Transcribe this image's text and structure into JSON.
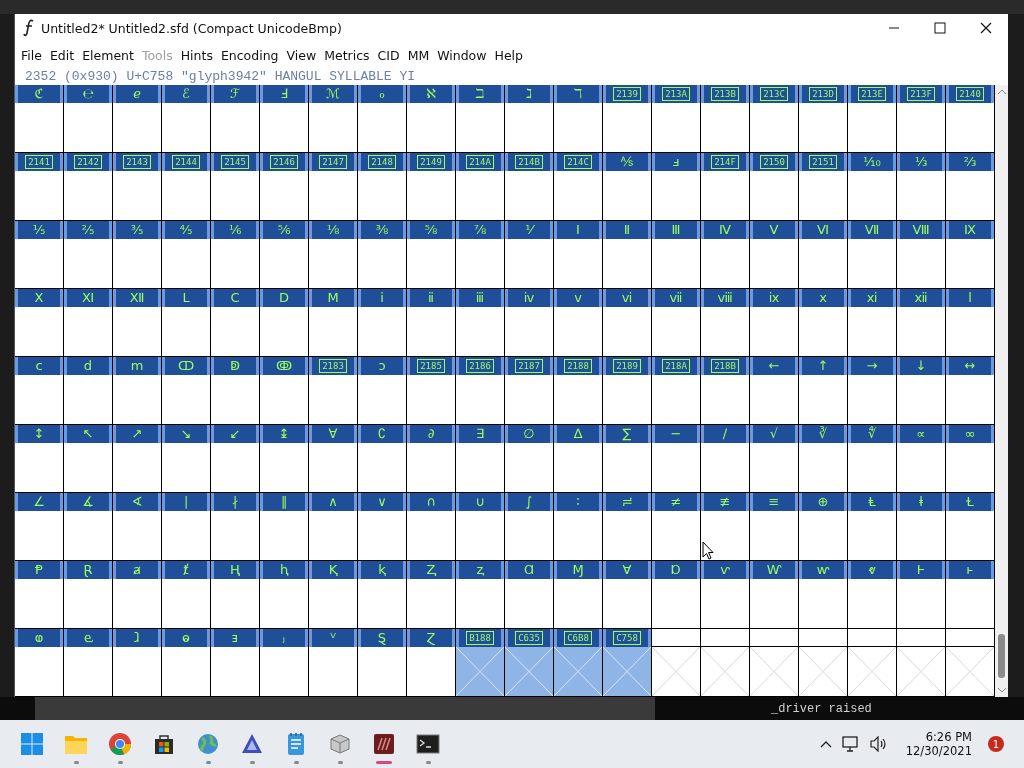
{
  "window": {
    "title": "Untitled2*  Untitled2.sfd (Compact UnicodeBmp)"
  },
  "menu": [
    {
      "label": "File",
      "disabled": false
    },
    {
      "label": "Edit",
      "disabled": false
    },
    {
      "label": "Element",
      "disabled": false
    },
    {
      "label": "Tools",
      "disabled": true
    },
    {
      "label": "Hints",
      "disabled": false
    },
    {
      "label": "Encoding",
      "disabled": false
    },
    {
      "label": "View",
      "disabled": false
    },
    {
      "label": "Metrics",
      "disabled": false
    },
    {
      "label": "CID",
      "disabled": false
    },
    {
      "label": "MM",
      "disabled": false
    },
    {
      "label": "Window",
      "disabled": false
    },
    {
      "label": "Help",
      "disabled": false
    }
  ],
  "status_line": "2352 (0x930) U+C758 \"glyph3942\" HANGUL SYLLABLE YI",
  "glyph_rows": [
    {
      "cells": [
        {
          "kind": "glyph",
          "label": "ℭ",
          "selected": false,
          "empty": false
        },
        {
          "kind": "glyph",
          "label": "℮",
          "selected": false,
          "empty": false
        },
        {
          "kind": "glyph",
          "label": "ℯ",
          "selected": false,
          "empty": false
        },
        {
          "kind": "glyph",
          "label": "ℰ",
          "selected": false,
          "empty": false
        },
        {
          "kind": "glyph",
          "label": "ℱ",
          "selected": false,
          "empty": false
        },
        {
          "kind": "glyph",
          "label": "Ⅎ",
          "selected": false,
          "empty": false
        },
        {
          "kind": "glyph",
          "label": "ℳ",
          "selected": false,
          "empty": false
        },
        {
          "kind": "glyph",
          "label": "ℴ",
          "selected": false,
          "empty": false
        },
        {
          "kind": "glyph",
          "label": "ℵ",
          "selected": false,
          "empty": false
        },
        {
          "kind": "glyph",
          "label": "ℶ",
          "selected": false,
          "empty": false
        },
        {
          "kind": "glyph",
          "label": "ℷ",
          "selected": false,
          "empty": false
        },
        {
          "kind": "glyph",
          "label": "ℸ",
          "selected": false,
          "empty": false
        },
        {
          "kind": "missing",
          "label": "2139",
          "selected": false,
          "empty": false
        },
        {
          "kind": "missing",
          "label": "213A",
          "selected": false,
          "empty": false
        },
        {
          "kind": "missing",
          "label": "213B",
          "selected": false,
          "empty": false
        },
        {
          "kind": "missing",
          "label": "213C",
          "selected": false,
          "empty": false
        },
        {
          "kind": "missing",
          "label": "213D",
          "selected": false,
          "empty": false
        },
        {
          "kind": "missing",
          "label": "213E",
          "selected": false,
          "empty": false
        },
        {
          "kind": "missing",
          "label": "213F",
          "selected": false,
          "empty": false
        },
        {
          "kind": "missing",
          "label": "2140",
          "selected": false,
          "empty": false
        }
      ]
    },
    {
      "cells": [
        {
          "kind": "missing",
          "label": "2141",
          "selected": false,
          "empty": false
        },
        {
          "kind": "missing",
          "label": "2142",
          "selected": false,
          "empty": false
        },
        {
          "kind": "missing",
          "label": "2143",
          "selected": false,
          "empty": false
        },
        {
          "kind": "missing",
          "label": "2144",
          "selected": false,
          "empty": false
        },
        {
          "kind": "missing",
          "label": "2145",
          "selected": false,
          "empty": false
        },
        {
          "kind": "missing",
          "label": "2146",
          "selected": false,
          "empty": false
        },
        {
          "kind": "missing",
          "label": "2147",
          "selected": false,
          "empty": false
        },
        {
          "kind": "missing",
          "label": "2148",
          "selected": false,
          "empty": false
        },
        {
          "kind": "missing",
          "label": "2149",
          "selected": false,
          "empty": false
        },
        {
          "kind": "missing",
          "label": "214A",
          "selected": false,
          "empty": false
        },
        {
          "kind": "missing",
          "label": "214B",
          "selected": false,
          "empty": false
        },
        {
          "kind": "missing",
          "label": "214C",
          "selected": false,
          "empty": false
        },
        {
          "kind": "glyph",
          "label": "⅍",
          "selected": false,
          "empty": false
        },
        {
          "kind": "glyph",
          "label": "ⅎ",
          "selected": false,
          "empty": false
        },
        {
          "kind": "missing",
          "label": "214F",
          "selected": false,
          "empty": false
        },
        {
          "kind": "missing",
          "label": "2150",
          "selected": false,
          "empty": false
        },
        {
          "kind": "missing",
          "label": "2151",
          "selected": false,
          "empty": false
        },
        {
          "kind": "glyph",
          "label": "⅒",
          "selected": false,
          "empty": false
        },
        {
          "kind": "glyph",
          "label": "⅓",
          "selected": false,
          "empty": false
        },
        {
          "kind": "glyph",
          "label": "⅔",
          "selected": false,
          "empty": false
        }
      ]
    },
    {
      "cells": [
        {
          "kind": "glyph",
          "label": "⅕",
          "selected": false,
          "empty": false
        },
        {
          "kind": "glyph",
          "label": "⅖",
          "selected": false,
          "empty": false
        },
        {
          "kind": "glyph",
          "label": "⅗",
          "selected": false,
          "empty": false
        },
        {
          "kind": "glyph",
          "label": "⅘",
          "selected": false,
          "empty": false
        },
        {
          "kind": "glyph",
          "label": "⅙",
          "selected": false,
          "empty": false
        },
        {
          "kind": "glyph",
          "label": "⅚",
          "selected": false,
          "empty": false
        },
        {
          "kind": "glyph",
          "label": "⅛",
          "selected": false,
          "empty": false
        },
        {
          "kind": "glyph",
          "label": "⅜",
          "selected": false,
          "empty": false
        },
        {
          "kind": "glyph",
          "label": "⅝",
          "selected": false,
          "empty": false
        },
        {
          "kind": "glyph",
          "label": "⅞",
          "selected": false,
          "empty": false
        },
        {
          "kind": "glyph",
          "label": "⅟",
          "selected": false,
          "empty": false
        },
        {
          "kind": "glyph",
          "label": "Ⅰ",
          "selected": false,
          "empty": false
        },
        {
          "kind": "glyph",
          "label": "Ⅱ",
          "selected": false,
          "empty": false
        },
        {
          "kind": "glyph",
          "label": "Ⅲ",
          "selected": false,
          "empty": false
        },
        {
          "kind": "glyph",
          "label": "Ⅳ",
          "selected": false,
          "empty": false
        },
        {
          "kind": "glyph",
          "label": "Ⅴ",
          "selected": false,
          "empty": false
        },
        {
          "kind": "glyph",
          "label": "Ⅵ",
          "selected": false,
          "empty": false
        },
        {
          "kind": "glyph",
          "label": "Ⅶ",
          "selected": false,
          "empty": false
        },
        {
          "kind": "glyph",
          "label": "Ⅷ",
          "selected": false,
          "empty": false
        },
        {
          "kind": "glyph",
          "label": "Ⅸ",
          "selected": false,
          "empty": false
        }
      ]
    },
    {
      "cells": [
        {
          "kind": "glyph",
          "label": "Ⅹ",
          "selected": false,
          "empty": false
        },
        {
          "kind": "glyph",
          "label": "Ⅺ",
          "selected": false,
          "empty": false
        },
        {
          "kind": "glyph",
          "label": "Ⅻ",
          "selected": false,
          "empty": false
        },
        {
          "kind": "glyph",
          "label": "Ⅼ",
          "selected": false,
          "empty": false
        },
        {
          "kind": "glyph",
          "label": "Ⅽ",
          "selected": false,
          "empty": false
        },
        {
          "kind": "glyph",
          "label": "Ⅾ",
          "selected": false,
          "empty": false
        },
        {
          "kind": "glyph",
          "label": "Ⅿ",
          "selected": false,
          "empty": false
        },
        {
          "kind": "glyph",
          "label": "ⅰ",
          "selected": false,
          "empty": false
        },
        {
          "kind": "glyph",
          "label": "ⅱ",
          "selected": false,
          "empty": false
        },
        {
          "kind": "glyph",
          "label": "ⅲ",
          "selected": false,
          "empty": false
        },
        {
          "kind": "glyph",
          "label": "ⅳ",
          "selected": false,
          "empty": false
        },
        {
          "kind": "glyph",
          "label": "ⅴ",
          "selected": false,
          "empty": false
        },
        {
          "kind": "glyph",
          "label": "ⅵ",
          "selected": false,
          "empty": false
        },
        {
          "kind": "glyph",
          "label": "ⅶ",
          "selected": false,
          "empty": false
        },
        {
          "kind": "glyph",
          "label": "ⅷ",
          "selected": false,
          "empty": false
        },
        {
          "kind": "glyph",
          "label": "ⅸ",
          "selected": false,
          "empty": false
        },
        {
          "kind": "glyph",
          "label": "ⅹ",
          "selected": false,
          "empty": false
        },
        {
          "kind": "glyph",
          "label": "ⅺ",
          "selected": false,
          "empty": false
        },
        {
          "kind": "glyph",
          "label": "ⅻ",
          "selected": false,
          "empty": false
        },
        {
          "kind": "glyph",
          "label": "ⅼ",
          "selected": false,
          "empty": false
        }
      ]
    },
    {
      "cells": [
        {
          "kind": "glyph",
          "label": "ⅽ",
          "selected": false,
          "empty": false
        },
        {
          "kind": "glyph",
          "label": "ⅾ",
          "selected": false,
          "empty": false
        },
        {
          "kind": "glyph",
          "label": "ⅿ",
          "selected": false,
          "empty": false
        },
        {
          "kind": "glyph",
          "label": "ↀ",
          "selected": false,
          "empty": false
        },
        {
          "kind": "glyph",
          "label": "ↁ",
          "selected": false,
          "empty": false
        },
        {
          "kind": "glyph",
          "label": "ↂ",
          "selected": false,
          "empty": false
        },
        {
          "kind": "missing",
          "label": "2183",
          "selected": false,
          "empty": false
        },
        {
          "kind": "glyph",
          "label": "ↄ",
          "selected": false,
          "empty": false
        },
        {
          "kind": "missing",
          "label": "2185",
          "selected": false,
          "empty": false
        },
        {
          "kind": "missing",
          "label": "2186",
          "selected": false,
          "empty": false
        },
        {
          "kind": "missing",
          "label": "2187",
          "selected": false,
          "empty": false
        },
        {
          "kind": "missing",
          "label": "2188",
          "selected": false,
          "empty": false
        },
        {
          "kind": "missing",
          "label": "2189",
          "selected": false,
          "empty": false
        },
        {
          "kind": "missing",
          "label": "218A",
          "selected": false,
          "empty": false
        },
        {
          "kind": "missing",
          "label": "218B",
          "selected": false,
          "empty": false
        },
        {
          "kind": "glyph",
          "label": "←",
          "selected": false,
          "empty": false
        },
        {
          "kind": "glyph",
          "label": "↑",
          "selected": false,
          "empty": false
        },
        {
          "kind": "glyph",
          "label": "→",
          "selected": false,
          "empty": false
        },
        {
          "kind": "glyph",
          "label": "↓",
          "selected": false,
          "empty": false
        },
        {
          "kind": "glyph",
          "label": "↔",
          "selected": false,
          "empty": false
        }
      ]
    },
    {
      "cells": [
        {
          "kind": "glyph",
          "label": "↕",
          "selected": false,
          "empty": false
        },
        {
          "kind": "glyph",
          "label": "↖",
          "selected": false,
          "empty": false
        },
        {
          "kind": "glyph",
          "label": "↗",
          "selected": false,
          "empty": false
        },
        {
          "kind": "glyph",
          "label": "↘",
          "selected": false,
          "empty": false
        },
        {
          "kind": "glyph",
          "label": "↙",
          "selected": false,
          "empty": false
        },
        {
          "kind": "glyph",
          "label": "↨",
          "selected": false,
          "empty": false
        },
        {
          "kind": "glyph",
          "label": "∀",
          "selected": false,
          "empty": false
        },
        {
          "kind": "glyph",
          "label": "∁",
          "selected": false,
          "empty": false
        },
        {
          "kind": "glyph",
          "label": "∂",
          "selected": false,
          "empty": false
        },
        {
          "kind": "glyph",
          "label": "∃",
          "selected": false,
          "empty": false
        },
        {
          "kind": "glyph",
          "label": "∅",
          "selected": false,
          "empty": false
        },
        {
          "kind": "glyph",
          "label": "∆",
          "selected": false,
          "empty": false
        },
        {
          "kind": "glyph",
          "label": "∑",
          "selected": false,
          "empty": false
        },
        {
          "kind": "glyph",
          "label": "−",
          "selected": false,
          "empty": false
        },
        {
          "kind": "glyph",
          "label": "∕",
          "selected": false,
          "empty": false
        },
        {
          "kind": "glyph",
          "label": "√",
          "selected": false,
          "empty": false
        },
        {
          "kind": "glyph",
          "label": "∛",
          "selected": false,
          "empty": false
        },
        {
          "kind": "glyph",
          "label": "∜",
          "selected": false,
          "empty": false
        },
        {
          "kind": "glyph",
          "label": "∝",
          "selected": false,
          "empty": false
        },
        {
          "kind": "glyph",
          "label": "∞",
          "selected": false,
          "empty": false
        }
      ]
    },
    {
      "cells": [
        {
          "kind": "glyph",
          "label": "∠",
          "selected": false,
          "empty": false
        },
        {
          "kind": "glyph",
          "label": "∡",
          "selected": false,
          "empty": false
        },
        {
          "kind": "glyph",
          "label": "∢",
          "selected": false,
          "empty": false
        },
        {
          "kind": "glyph",
          "label": "∣",
          "selected": false,
          "empty": false
        },
        {
          "kind": "glyph",
          "label": "∤",
          "selected": false,
          "empty": false
        },
        {
          "kind": "glyph",
          "label": "∥",
          "selected": false,
          "empty": false
        },
        {
          "kind": "glyph",
          "label": "∧",
          "selected": false,
          "empty": false
        },
        {
          "kind": "glyph",
          "label": "∨",
          "selected": false,
          "empty": false
        },
        {
          "kind": "glyph",
          "label": "∩",
          "selected": false,
          "empty": false
        },
        {
          "kind": "glyph",
          "label": "∪",
          "selected": false,
          "empty": false
        },
        {
          "kind": "glyph",
          "label": "∫",
          "selected": false,
          "empty": false
        },
        {
          "kind": "glyph",
          "label": "∶",
          "selected": false,
          "empty": false
        },
        {
          "kind": "glyph",
          "label": "≓",
          "selected": false,
          "empty": false
        },
        {
          "kind": "glyph",
          "label": "≠",
          "selected": false,
          "empty": false
        },
        {
          "kind": "glyph",
          "label": "≢",
          "selected": false,
          "empty": false
        },
        {
          "kind": "glyph",
          "label": "≡",
          "selected": false,
          "empty": false
        },
        {
          "kind": "glyph",
          "label": "⊕",
          "selected": false,
          "empty": false
        },
        {
          "kind": "glyph",
          "label": "Ⱡ",
          "selected": false,
          "empty": false
        },
        {
          "kind": "glyph",
          "label": "ⱡ",
          "selected": false,
          "empty": false
        },
        {
          "kind": "glyph",
          "label": "Ɫ",
          "selected": false,
          "empty": false
        }
      ]
    },
    {
      "cells": [
        {
          "kind": "glyph",
          "label": "Ᵽ",
          "selected": false,
          "empty": false
        },
        {
          "kind": "glyph",
          "label": "Ɽ",
          "selected": false,
          "empty": false
        },
        {
          "kind": "glyph",
          "label": "ⱥ",
          "selected": false,
          "empty": false
        },
        {
          "kind": "glyph",
          "label": "ⱦ",
          "selected": false,
          "empty": false
        },
        {
          "kind": "glyph",
          "label": "Ⱨ",
          "selected": false,
          "empty": false
        },
        {
          "kind": "glyph",
          "label": "ⱨ",
          "selected": false,
          "empty": false
        },
        {
          "kind": "glyph",
          "label": "Ⱪ",
          "selected": false,
          "empty": false
        },
        {
          "kind": "glyph",
          "label": "ⱪ",
          "selected": false,
          "empty": false
        },
        {
          "kind": "glyph",
          "label": "Ⱬ",
          "selected": false,
          "empty": false
        },
        {
          "kind": "glyph",
          "label": "ⱬ",
          "selected": false,
          "empty": false
        },
        {
          "kind": "glyph",
          "label": "Ɑ",
          "selected": false,
          "empty": false
        },
        {
          "kind": "glyph",
          "label": "Ɱ",
          "selected": false,
          "empty": false
        },
        {
          "kind": "glyph",
          "label": "Ɐ",
          "selected": false,
          "empty": false
        },
        {
          "kind": "glyph",
          "label": "Ɒ",
          "selected": false,
          "empty": false
        },
        {
          "kind": "glyph",
          "label": "ⱱ",
          "selected": false,
          "empty": false
        },
        {
          "kind": "glyph",
          "label": "Ⱳ",
          "selected": false,
          "empty": false
        },
        {
          "kind": "glyph",
          "label": "ⱳ",
          "selected": false,
          "empty": false
        },
        {
          "kind": "glyph",
          "label": "ⱴ",
          "selected": false,
          "empty": false
        },
        {
          "kind": "glyph",
          "label": "Ⱶ",
          "selected": false,
          "empty": false
        },
        {
          "kind": "glyph",
          "label": "ⱶ",
          "selected": false,
          "empty": false
        }
      ]
    },
    {
      "cells": [
        {
          "kind": "glyph",
          "label": "ⱷ",
          "selected": false,
          "empty": false
        },
        {
          "kind": "glyph",
          "label": "ⱸ",
          "selected": false,
          "empty": false
        },
        {
          "kind": "glyph",
          "label": "ⱹ",
          "selected": false,
          "empty": false
        },
        {
          "kind": "glyph",
          "label": "ⱺ",
          "selected": false,
          "empty": false
        },
        {
          "kind": "glyph",
          "label": "ⱻ",
          "selected": false,
          "empty": false
        },
        {
          "kind": "glyph",
          "label": "ⱼ",
          "selected": false,
          "empty": false
        },
        {
          "kind": "glyph",
          "label": "ⱽ",
          "selected": false,
          "empty": false
        },
        {
          "kind": "glyph",
          "label": "Ȿ",
          "selected": false,
          "empty": false
        },
        {
          "kind": "glyph",
          "label": "Ɀ",
          "selected": false,
          "empty": false
        },
        {
          "kind": "missing",
          "label": "B188",
          "selected": true,
          "empty": true
        },
        {
          "kind": "missing",
          "label": "C635",
          "selected": true,
          "empty": true
        },
        {
          "kind": "missing",
          "label": "C6B8",
          "selected": true,
          "empty": true
        },
        {
          "kind": "missing",
          "label": "C758",
          "selected": true,
          "empty": true
        },
        {
          "kind": "blank",
          "selected": false,
          "empty": true
        },
        {
          "kind": "blank",
          "selected": false,
          "empty": true
        },
        {
          "kind": "blank",
          "selected": false,
          "empty": true
        },
        {
          "kind": "blank",
          "selected": false,
          "empty": true
        },
        {
          "kind": "blank",
          "selected": false,
          "empty": true
        },
        {
          "kind": "blank",
          "selected": false,
          "empty": true
        },
        {
          "kind": "blank",
          "selected": false,
          "empty": true
        }
      ]
    }
  ],
  "background_terminal_text": "_driver raised",
  "taskbar": {
    "apps": [
      {
        "kind": "start",
        "running": false,
        "selected": false
      },
      {
        "kind": "folder",
        "running": true,
        "selected": false
      },
      {
        "kind": "browser",
        "running": true,
        "selected": false
      },
      {
        "kind": "store",
        "running": false,
        "selected": false
      },
      {
        "kind": "globe",
        "running": true,
        "selected": false
      },
      {
        "kind": "triangle",
        "running": true,
        "selected": false
      },
      {
        "kind": "notepad",
        "running": true,
        "selected": false
      },
      {
        "kind": "package",
        "running": true,
        "selected": false
      },
      {
        "kind": "fontapp",
        "running": true,
        "selected": true
      },
      {
        "kind": "terminal",
        "running": true,
        "selected": false
      }
    ],
    "time": "6:26 PM",
    "date": "12/30/2021",
    "notification_count": "1"
  }
}
